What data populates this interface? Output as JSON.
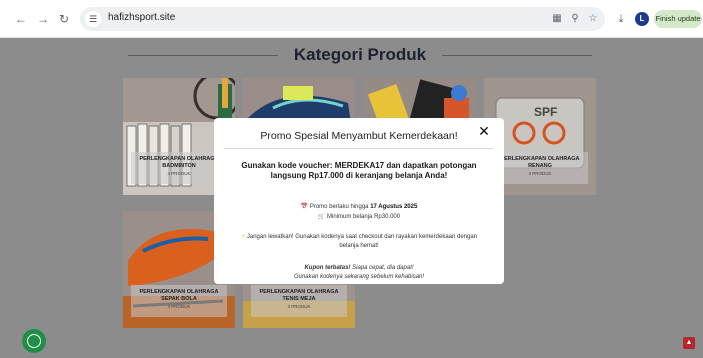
{
  "browser": {
    "url": "hafizhsport.site",
    "finish_update_label": "Finish update",
    "profile_initial": "L",
    "back_icon": "arrow-left-icon",
    "forward_icon": "arrow-right-icon",
    "reload_icon": "reload-icon"
  },
  "page": {
    "section_title": "Kategori Produk",
    "categories": [
      {
        "name": "PERLENGKAPAN OLAHRAGA BADMINTON",
        "count": "4 PRODUK"
      },
      {
        "name": "",
        "count": ""
      },
      {
        "name": "",
        "count": ""
      },
      {
        "name": "PERLENGKAPAN OLAHRAGA RENANG",
        "count": "3 PRODUK"
      },
      {
        "name": "PERLENGKAPAN OLAHRAGA SEPAK BOLA",
        "count": "4 PRODUK"
      },
      {
        "name": "PERLENGKAPAN OLAHRAGA TENIS MEJA",
        "count": "3 PRODUK"
      }
    ],
    "colors": {
      "accent": "#b5262e",
      "whatsapp": "#1f8f47",
      "finish_update_bg": "#d5e8c9"
    }
  },
  "modal": {
    "title": "Promo Spesial Menyambut Kemerdekaan!",
    "headline": "Gunakan kode voucher: MERDEKA17 dan dapatkan potongan langsung Rp17.000 di keranjang belanja Anda!",
    "period_prefix": "Promo berlaku hingga ",
    "period_date": "17 Agustus 2025",
    "minimum": "Minimum belanja Rp30.000",
    "message": "Jangan lewatkan! Gunakan kodenya saat checkout dan rayakan kemerdekaan dengan belanja hemat!",
    "kupon_bold": "Kupon terbatas!",
    "kupon_rest": " Siapa cepat, dia dapat!",
    "kupon_line2": "Gunakan kodenya sekarang sebelum kehabisan!"
  }
}
